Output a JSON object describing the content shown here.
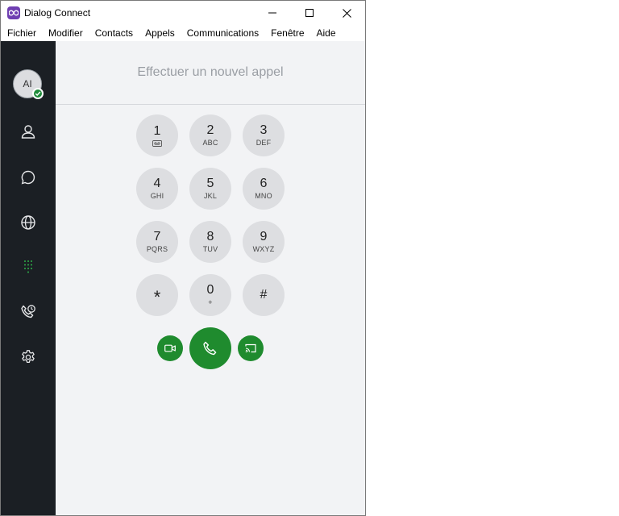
{
  "window": {
    "title": "Dialog Connect"
  },
  "menu": [
    "Fichier",
    "Modifier",
    "Contacts",
    "Appels",
    "Communications",
    "Fenêtre",
    "Aide"
  ],
  "user": {
    "initials": "AI",
    "status": "available"
  },
  "dialer": {
    "placeholder": "Effectuer un nouvel appel",
    "keys": [
      {
        "digit": "1",
        "letters": ""
      },
      {
        "digit": "2",
        "letters": "ABC"
      },
      {
        "digit": "3",
        "letters": "DEF"
      },
      {
        "digit": "4",
        "letters": "GHI"
      },
      {
        "digit": "5",
        "letters": "JKL"
      },
      {
        "digit": "6",
        "letters": "MNO"
      },
      {
        "digit": "7",
        "letters": "PQRS"
      },
      {
        "digit": "8",
        "letters": "TUV"
      },
      {
        "digit": "9",
        "letters": "WXYZ"
      },
      {
        "digit": "*",
        "letters": ""
      },
      {
        "digit": "0",
        "letters": "+"
      },
      {
        "digit": "#",
        "letters": ""
      }
    ]
  },
  "colors": {
    "sidebar": "#1b1f24",
    "accent_green": "#1f8b2e",
    "key_bg": "#dddee1",
    "main_bg": "#f2f3f5"
  },
  "icons": [
    "app-logo-icon",
    "minimize-icon",
    "maximize-icon",
    "close-icon",
    "contacts-icon",
    "chat-icon",
    "globe-icon",
    "dialpad-icon",
    "call-history-icon",
    "settings-icon",
    "voicemail-icon",
    "video-icon",
    "phone-icon",
    "cast-icon"
  ]
}
